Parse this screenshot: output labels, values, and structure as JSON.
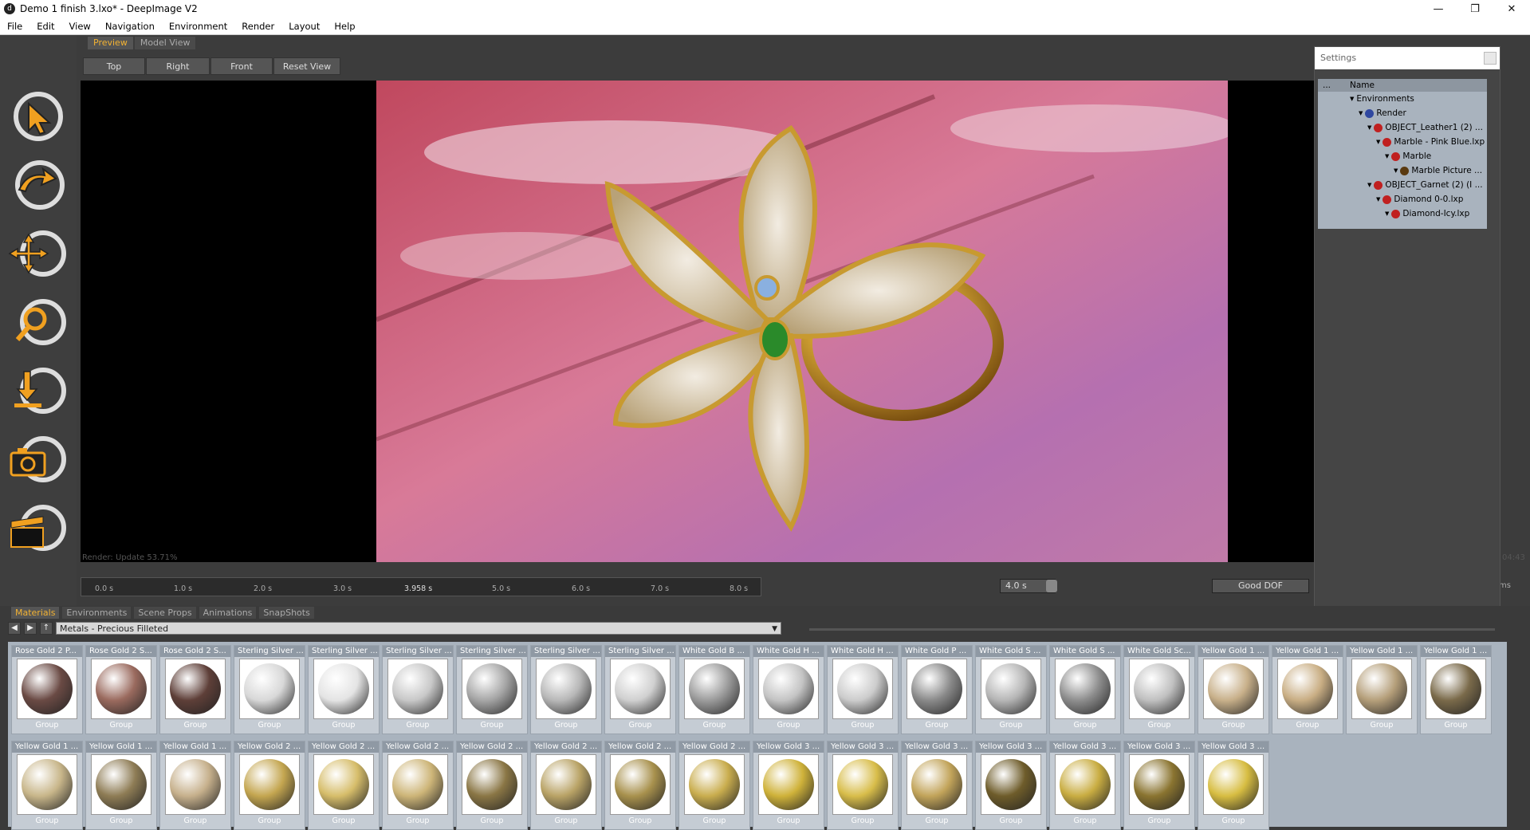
{
  "window": {
    "title": "Demo 1 finish 3.lxo* - DeepImage V2",
    "minimize": "—",
    "restore": "❐",
    "close": "✕"
  },
  "menu": [
    "File",
    "Edit",
    "View",
    "Navigation",
    "Environment",
    "Render",
    "Layout",
    "Help"
  ],
  "view_tabs": [
    "Preview",
    "Model View"
  ],
  "view_buttons": [
    "Top",
    "Right",
    "Front",
    "Reset View"
  ],
  "tools": [
    "select-tool-icon",
    "rotate-tool-icon",
    "move-tool-icon",
    "zoom-tool-icon",
    "drop-tool-icon",
    "camera-tool-icon",
    "clapper-tool-icon"
  ],
  "status": "Render: Update 53.71%",
  "time_right": "04:43",
  "timeline": {
    "ticks": [
      "0.0 s",
      "1.0 s",
      "2.0 s",
      "3.0 s",
      "3.958 s",
      "5.0 s",
      "6.0 s",
      "7.0 s",
      "8.0 s"
    ],
    "duration": "4.0 s",
    "quality": "Good DOF",
    "ellipsis": "ms"
  },
  "settings": {
    "title": "Settings",
    "col_dots": "...",
    "col_name": "Name",
    "tree": [
      {
        "label": "Environments",
        "indent": 0,
        "color": ""
      },
      {
        "label": "Render",
        "indent": 1,
        "color": "#3048a0"
      },
      {
        "label": "OBJECT_Leather1 (2) ...",
        "indent": 2,
        "color": "#c02020"
      },
      {
        "label": "Marble - Pink Blue.lxp",
        "indent": 3,
        "color": "#c02020"
      },
      {
        "label": "Marble",
        "indent": 4,
        "color": "#c02020"
      },
      {
        "label": "Marble Picture ...",
        "indent": 5,
        "color": "#5a3a10"
      },
      {
        "label": "OBJECT_Garnet (2) (I ...",
        "indent": 2,
        "color": "#c02020"
      },
      {
        "label": "Diamond 0-0.lxp",
        "indent": 3,
        "color": "#c02020"
      },
      {
        "label": "Diamond-Icy.lxp",
        "indent": 4,
        "color": "#c02020"
      }
    ]
  },
  "bottom_tabs": [
    "Materials",
    "Environments",
    "Scene Props",
    "Animations",
    "SnapShots"
  ],
  "library": "Metals - Precious Filleted",
  "tile_type": "Group",
  "materials_row1": [
    {
      "label": "Rose Gold 2 P...",
      "color": "#6a4a44"
    },
    {
      "label": "Rose Gold 2 S...",
      "color": "#9a6a5e"
    },
    {
      "label": "Rose Gold 2 S...",
      "color": "#5e3f38"
    },
    {
      "label": "Sterling Silver ...",
      "color": "#d8d8d8"
    },
    {
      "label": "Sterling Silver ...",
      "color": "#e4e4e4"
    },
    {
      "label": "Sterling Silver ...",
      "color": "#c8c8c8"
    },
    {
      "label": "Sterling Silver ...",
      "color": "#a6a6a6"
    },
    {
      "label": "Sterling Silver ...",
      "color": "#b8b8b8"
    },
    {
      "label": "Sterling Silver ...",
      "color": "#d0d0d0"
    },
    {
      "label": "White Gold B ...",
      "color": "#9c9c9c"
    },
    {
      "label": "White Gold H ...",
      "color": "#c4c4c4"
    },
    {
      "label": "White Gold H ...",
      "color": "#cccccc"
    },
    {
      "label": "White Gold P ...",
      "color": "#8a8a8a"
    },
    {
      "label": "White Gold S ...",
      "color": "#b6b6b6"
    },
    {
      "label": "White Gold S ...",
      "color": "#8e8e8e"
    },
    {
      "label": "White Gold Sc...",
      "color": "#c0c0c0"
    },
    {
      "label": "Yellow Gold 1 ...",
      "color": "#c8b08a"
    },
    {
      "label": "Yellow Gold 1 ...",
      "color": "#c9ae84"
    },
    {
      "label": "Yellow Gold 1 ...",
      "color": "#b59f7a"
    },
    {
      "label": "Yellow Gold 1 ...",
      "color": "#7a6a4a"
    }
  ],
  "materials_row2": [
    {
      "label": "Yellow Gold 1 ...",
      "color": "#c8b68a"
    },
    {
      "label": "Yellow Gold 1 ...",
      "color": "#8e7c55"
    },
    {
      "label": "Yellow Gold 1 ...",
      "color": "#c6b08c"
    },
    {
      "label": "Yellow Gold 2 ...",
      "color": "#c4a650"
    },
    {
      "label": "Yellow Gold 2 ...",
      "color": "#d6bd6a"
    },
    {
      "label": "Yellow Gold 2 ...",
      "color": "#cdb578"
    },
    {
      "label": "Yellow Gold 2 ...",
      "color": "#8a7645"
    },
    {
      "label": "Yellow Gold 2 ...",
      "color": "#b9a366"
    },
    {
      "label": "Yellow Gold 2 ...",
      "color": "#a8914d"
    },
    {
      "label": "Yellow Gold 2 ...",
      "color": "#c9ad4e"
    },
    {
      "label": "Yellow Gold 3 ...",
      "color": "#cfb23a"
    },
    {
      "label": "Yellow Gold 3 ...",
      "color": "#d8bd4a"
    },
    {
      "label": "Yellow Gold 3 ...",
      "color": "#c2a45a"
    },
    {
      "label": "Yellow Gold 3 ...",
      "color": "#6e5c2a"
    },
    {
      "label": "Yellow Gold 3 ...",
      "color": "#c9ad42"
    },
    {
      "label": "Yellow Gold 3 ...",
      "color": "#8a7430"
    },
    {
      "label": "Yellow Gold 3 ...",
      "color": "#d7bd42"
    }
  ]
}
